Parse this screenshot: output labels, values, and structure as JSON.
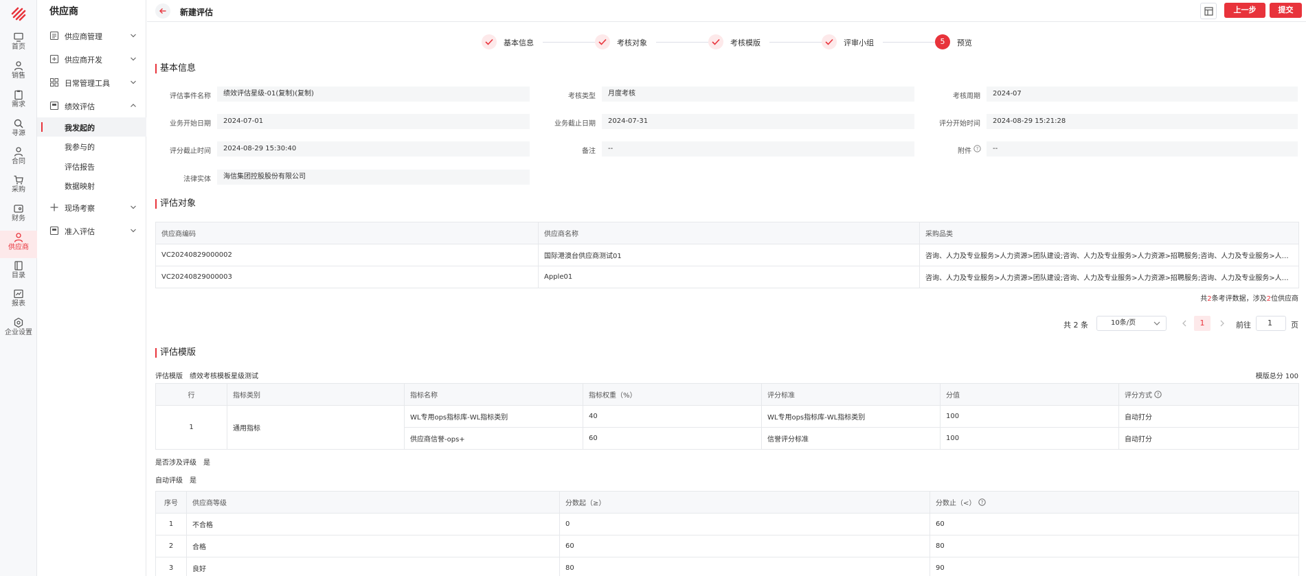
{
  "rail": {
    "items": [
      {
        "label": "首页",
        "icon": "monitor-icon"
      },
      {
        "label": "销售",
        "icon": "person-icon"
      },
      {
        "label": "需求",
        "icon": "clipboard-icon"
      },
      {
        "label": "寻源",
        "icon": "search-icon"
      },
      {
        "label": "合同",
        "icon": "person-icon"
      },
      {
        "label": "采购",
        "icon": "cart-icon"
      },
      {
        "label": "财务",
        "icon": "wallet-icon"
      },
      {
        "label": "供应商",
        "icon": "person-icon"
      },
      {
        "label": "目录",
        "icon": "book-icon"
      },
      {
        "label": "报表",
        "icon": "chart-icon"
      },
      {
        "label": "企业设置",
        "icon": "hexagon-icon"
      }
    ],
    "active_index": 7,
    "accent_color": "#e8333b"
  },
  "sidebar": {
    "title": "供应商",
    "groups": [
      {
        "label": "供应商管理",
        "icon": "list-icon"
      },
      {
        "label": "供应商开发",
        "icon": "edit-icon"
      },
      {
        "label": "日常管理工具",
        "icon": "grid-icon"
      },
      {
        "label": "绩效评估",
        "icon": "document-icon"
      },
      {
        "label": "现场考察",
        "icon": "plus-icon"
      },
      {
        "label": "准入评估",
        "icon": "document-icon"
      }
    ],
    "perf_sub": [
      {
        "label": "我发起的"
      },
      {
        "label": "我参与的"
      },
      {
        "label": "评估报告"
      },
      {
        "label": "数据映射"
      }
    ]
  },
  "header": {
    "title": "新建评估",
    "prev_label": "上一步",
    "submit_label": "提交"
  },
  "steps": [
    {
      "label": "基本信息",
      "status": "done"
    },
    {
      "label": "考核对象",
      "status": "done"
    },
    {
      "label": "考核模版",
      "status": "done"
    },
    {
      "label": "评审小组",
      "status": "done"
    },
    {
      "label": "预览",
      "status": "current",
      "number": "5"
    }
  ],
  "basic": {
    "section_title": "基本信息",
    "fields": [
      {
        "label": "评估事件名称",
        "value": "绩效评估星级-01(复制)(复制)"
      },
      {
        "label": "考核类型",
        "value": "月度考核"
      },
      {
        "label": "考核周期",
        "value": "2024-07"
      },
      {
        "label": "业务开始日期",
        "value": "2024-07-01"
      },
      {
        "label": "业务截止日期",
        "value": "2024-07-31"
      },
      {
        "label": "评分开始时间",
        "value": "2024-08-29 15:21:28"
      },
      {
        "label": "评分截止时间",
        "value": "2024-08-29 15:30:40"
      },
      {
        "label": "备注",
        "value": "--"
      },
      {
        "label": "附件",
        "value": "--"
      },
      {
        "label": "法律实体",
        "value": "海信集团控股股份有限公司"
      }
    ]
  },
  "objects": {
    "section_title": "评估对象",
    "headers": [
      "供应商编码",
      "供应商名称",
      "采购品类"
    ],
    "rows": [
      [
        "VC20240829000002",
        "国际港澳台供应商测试01",
        "咨询、人力及专业服务>人力资源>团队建设;咨询、人力及专业服务>人力资源>招聘服务;咨询、人力及专业服务>人力资源>..."
      ],
      [
        "VC20240829000003",
        "Apple01",
        "咨询、人力及专业服务>人力资源>团队建设;咨询、人力及专业服务>人力资源>招聘服务;咨询、人力及专业服务>人力资源>..."
      ]
    ],
    "summary_a": "共",
    "summary_count": "2",
    "summary_b": "条考评数据，涉及",
    "summary_suppliers": "2",
    "summary_c": "位供应商",
    "pager": {
      "total": "共 2 条",
      "page_size": "10条/页",
      "current": "1",
      "goto_label": "前往",
      "goto_value": "1",
      "goto_suffix": "页"
    }
  },
  "template": {
    "section_title": "评估模版",
    "template_label": "评估模版",
    "template_name": "绩效考核模板星级测试",
    "total_score": "模版总分 100",
    "headers": [
      "行",
      "指标类别",
      "指标名称",
      "指标权重（%）",
      "评分标准",
      "分值",
      "评分方式"
    ],
    "row_no": "1",
    "category": "通用指标",
    "rows": [
      {
        "name": "WL专用ops指标库-WL指标类别",
        "weight": "40",
        "standard": "WL专用ops指标库-WL指标类别",
        "score": "100",
        "method": "自动打分"
      },
      {
        "name": "供应商信誉-ops+",
        "weight": "60",
        "standard": "信誉评分标准",
        "score": "100",
        "method": "自动打分"
      }
    ],
    "rating_label": "是否涉及评级",
    "rating_value": "是",
    "auto_label": "自动评级",
    "auto_value": "是",
    "grade_headers": [
      "序号",
      "供应商等级",
      "分数起（≥）",
      "分数止（<）"
    ],
    "grades": [
      [
        "1",
        "不合格",
        "0",
        "60"
      ],
      [
        "2",
        "合格",
        "60",
        "80"
      ],
      [
        "3",
        "良好",
        "80",
        "90"
      ]
    ]
  }
}
